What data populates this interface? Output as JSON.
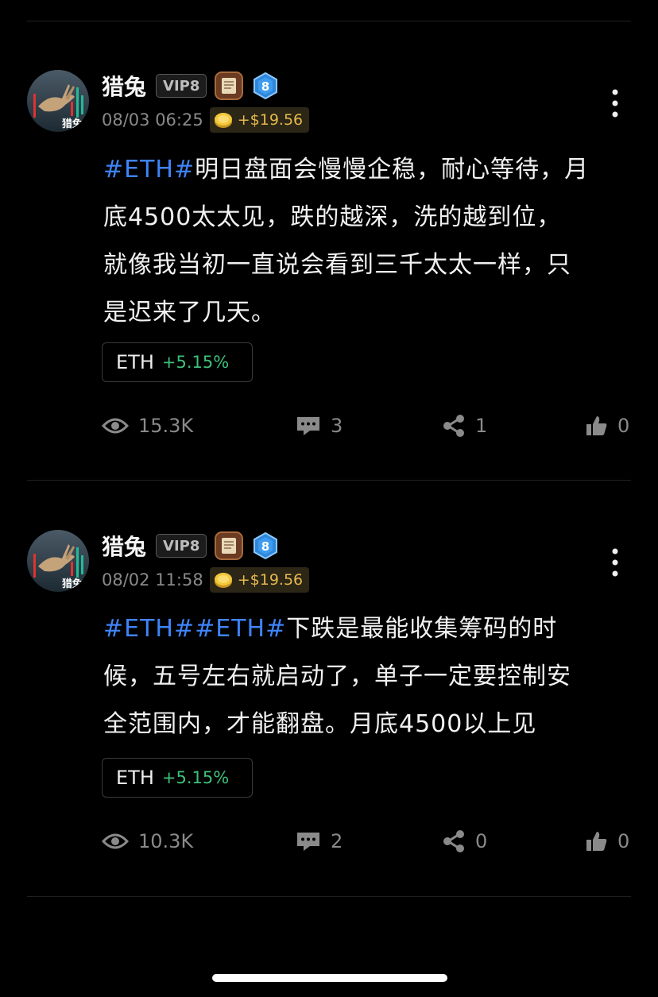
{
  "posts": [
    {
      "author": "猎兔",
      "vip": "VIP8",
      "level": "8",
      "time": "08/03 06:25",
      "reward": "+$19.56",
      "hashtags": [
        "#ETH#"
      ],
      "text_lines": [
        "明日盘面会慢慢企稳，耐心等待，月",
        "底4500太太见，跌的越深，洗的越到位，",
        "就像我当初一直说会看到三千太太一样，只",
        "是迟来了几天。"
      ],
      "ticker": {
        "symbol": "ETH",
        "change": "+5.15%"
      },
      "stats": {
        "views": "15.3K",
        "comments": "3",
        "shares": "1",
        "likes": "0"
      }
    },
    {
      "author": "猎兔",
      "vip": "VIP8",
      "level": "8",
      "time": "08/02 11:58",
      "reward": "+$19.56",
      "hashtags": [
        "#ETH#",
        "#ETH#"
      ],
      "text_lines": [
        "下跌是最能收集筹码的时",
        "候，五号左右就启动了，单子一定要控制安",
        "全范围内，才能翻盘。月底4500以上见"
      ],
      "ticker": {
        "symbol": "ETH",
        "change": "+5.15%"
      },
      "stats": {
        "views": "10.3K",
        "comments": "2",
        "shares": "0",
        "likes": "0"
      }
    }
  ],
  "colors": {
    "background": "#000000",
    "hashtag": "#3f83f8",
    "positive": "#3ec07a",
    "reward": "#e6b84b",
    "muted": "#8a8a8a"
  },
  "icons": [
    "more-vertical-icon",
    "coin-icon",
    "eye-icon",
    "comment-icon",
    "share-icon",
    "thumbs-up-icon",
    "level-badge-icon",
    "scroll-badge-icon"
  ]
}
